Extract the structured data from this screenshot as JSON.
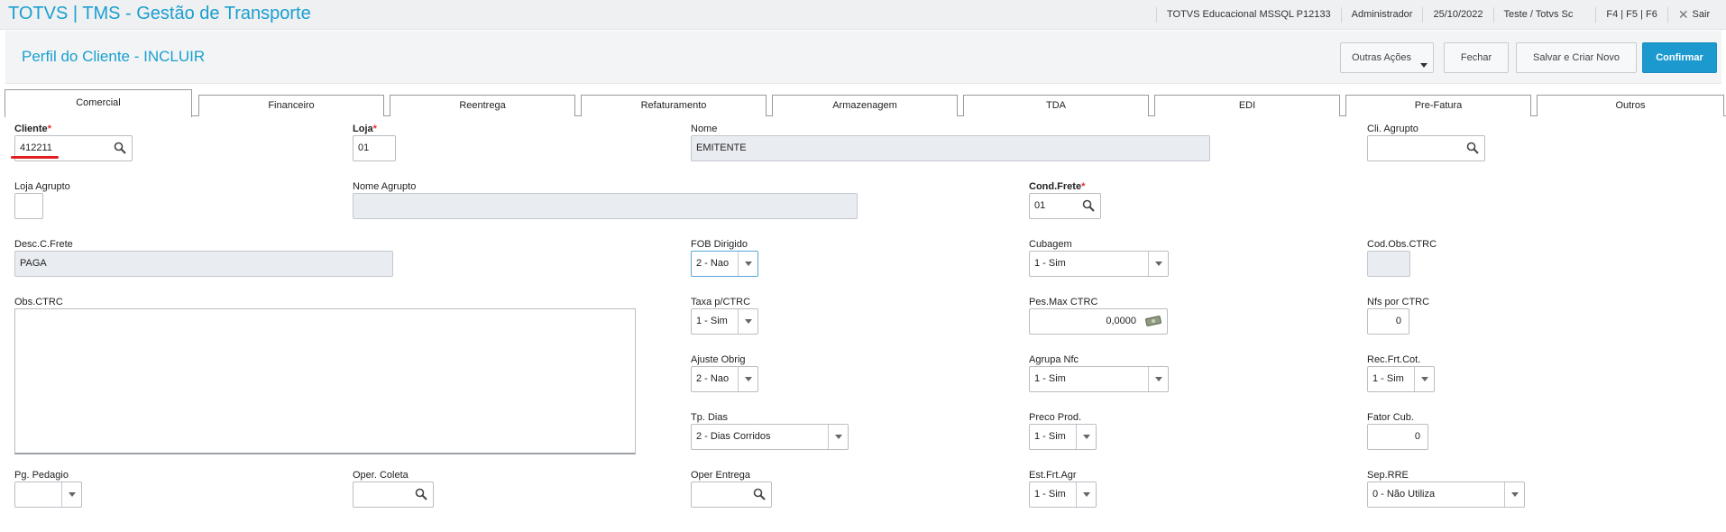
{
  "app": {
    "title": "TOTVS | TMS - Gestão de Transporte",
    "environment": "TOTVS Educacional MSSQL P12133",
    "user": "Administrador",
    "date": "25/10/2022",
    "company": "Teste / Totvs Sc",
    "shortcuts": "F4 | F5 | F6",
    "exit_label": "Sair"
  },
  "header": {
    "title": "Perfil do Cliente - INCLUIR",
    "buttons": {
      "other_actions": "Outras Ações",
      "close": "Fechar",
      "save_new": "Salvar e Criar Novo",
      "confirm": "Confirmar"
    }
  },
  "tabs": [
    "Comercial",
    "Financeiro",
    "Reentrega",
    "Refaturamento",
    "Armazenagem",
    "TDA",
    "EDI",
    "Pre-Fatura",
    "Outros"
  ],
  "form": {
    "cliente": {
      "label": "Cliente",
      "value": "412211"
    },
    "loja": {
      "label": "Loja",
      "value": "01"
    },
    "nome": {
      "label": "Nome",
      "value": "EMITENTE"
    },
    "cli_agrupo": {
      "label": "Cli. Agrupto",
      "value": ""
    },
    "loja_agrupto": {
      "label": "Loja Agrupto",
      "value": ""
    },
    "nome_agrupto": {
      "label": "Nome Agrupto",
      "value": ""
    },
    "cond_frete": {
      "label": "Cond.Frete",
      "value": "01"
    },
    "desc_c_frete": {
      "label": "Desc.C.Frete",
      "value": "PAGA"
    },
    "fob_dirigido": {
      "label": "FOB Dirigido",
      "value": "2 - Nao"
    },
    "cubagem": {
      "label": "Cubagem",
      "value": "1 - Sim"
    },
    "cod_obs_ctrc": {
      "label": "Cod.Obs.CTRC",
      "value": ""
    },
    "obs_ctrc": {
      "label": "Obs.CTRC",
      "value": ""
    },
    "taxa_ctrc": {
      "label": "Taxa p/CTRC",
      "value": "1 - Sim"
    },
    "pes_max_ctrc": {
      "label": "Pes.Max CTRC",
      "value": "0,0000"
    },
    "nfs_por_ctrc": {
      "label": "Nfs por CTRC",
      "value": "0"
    },
    "ajuste_obrig": {
      "label": "Ajuste Obrig",
      "value": "2 - Nao"
    },
    "agrupa_nfc": {
      "label": "Agrupa Nfc",
      "value": "1 - Sim"
    },
    "rec_frt_cot": {
      "label": "Rec.Frt.Cot.",
      "value": "1 - Sim"
    },
    "tp_dias": {
      "label": "Tp. Dias",
      "value": "2 - Dias Corridos"
    },
    "preco_prod": {
      "label": "Preco Prod.",
      "value": "1 - Sim"
    },
    "fator_cub": {
      "label": "Fator Cub.",
      "value": "0"
    },
    "pg_pedagio": {
      "label": "Pg. Pedagio",
      "value": ""
    },
    "oper_coleta": {
      "label": "Oper. Coleta",
      "value": ""
    },
    "oper_entrega": {
      "label": "Oper Entrega",
      "value": ""
    },
    "est_frt_agr": {
      "label": "Est.Frt.Agr",
      "value": "1 - Sim"
    },
    "sep_rre": {
      "label": "Sep.RRE",
      "value": "0 - Não Utiliza"
    }
  },
  "colors": {
    "accent": "#1a9fd0",
    "primary_button": "#1c9ad0",
    "required": "#e03030",
    "annotation": "#e02020"
  }
}
